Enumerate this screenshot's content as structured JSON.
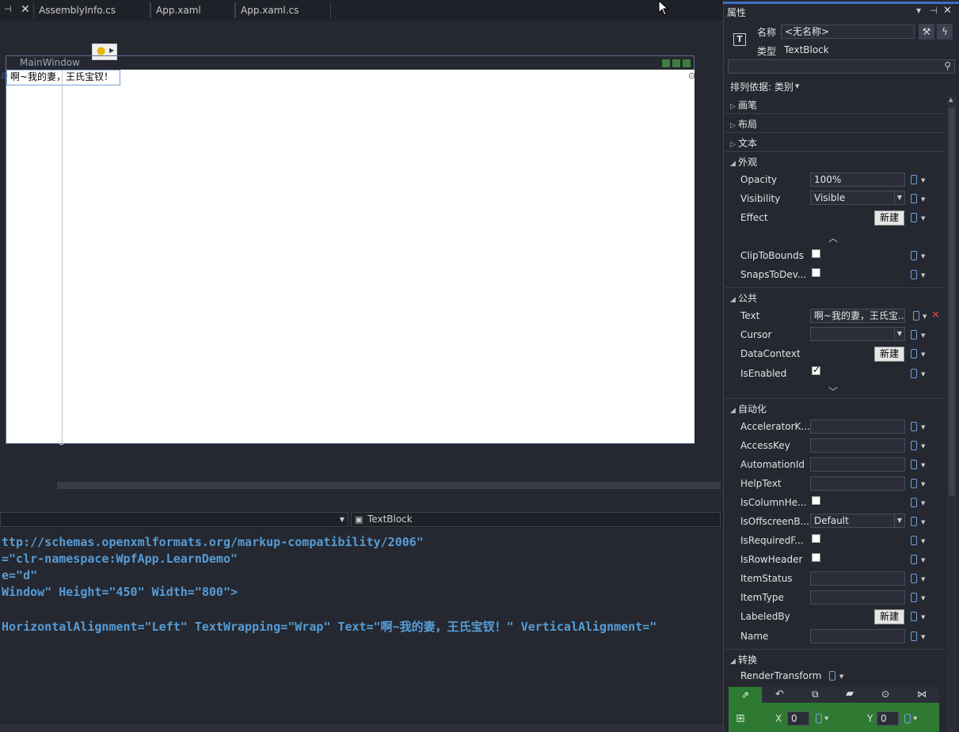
{
  "tabs": [
    "AssemblyInfo.cs",
    "App.xaml",
    "App.xaml.cs"
  ],
  "designer": {
    "window_title": "MainWindow",
    "textblock_text": "啊~我的妻，王氏宝钗！"
  },
  "editor": {
    "breadcrumb_right": "TextBlock",
    "lines": [
      {
        "text": "ttp://schemas.openxmlformats.org/markup-compatibility/2006\""
      },
      {
        "text": "=\"clr-namespace:WpfApp.LearnDemo\""
      },
      {
        "text": "e=\"d\""
      },
      {
        "text": "Window\" Height=\"450\" Width=\"800\">"
      },
      {
        "text": ""
      },
      {
        "text": "HorizontalAlignment=\"Left\" TextWrapping=\"Wrap\" Text=\"啊~我的妻，王氏宝钗！\" VerticalAlignment=\""
      }
    ]
  },
  "props": {
    "header": "属性",
    "name_label": "名称",
    "name_value": "<无名称>",
    "type_label": "类型",
    "type_value": "TextBlock",
    "sort_label": "排列依据: 类别",
    "collapsed_cats": [
      "画笔",
      "布局",
      "文本"
    ],
    "appearance": {
      "title": "外观",
      "opacity_label": "Opacity",
      "opacity_value": "100%",
      "visibility_label": "Visibility",
      "visibility_value": "Visible",
      "effect_label": "Effect",
      "new_btn": "新建",
      "clip_label": "ClipToBounds",
      "snaps_label": "SnapsToDev..."
    },
    "common": {
      "title": "公共",
      "text_label": "Text",
      "text_value": "啊~我的妻，王氏宝...",
      "cursor_label": "Cursor",
      "datacontext_label": "DataContext",
      "isenabled_label": "IsEnabled"
    },
    "automation": {
      "title": "自动化",
      "rows": [
        {
          "label": "AcceleratorK...",
          "kind": "field"
        },
        {
          "label": "AccessKey",
          "kind": "field"
        },
        {
          "label": "AutomationId",
          "kind": "field"
        },
        {
          "label": "HelpText",
          "kind": "field"
        },
        {
          "label": "IsColumnHe...",
          "kind": "check"
        },
        {
          "label": "IsOffscreenB...",
          "kind": "combo",
          "value": "Default"
        },
        {
          "label": "IsRequiredF...",
          "kind": "check"
        },
        {
          "label": "IsRowHeader",
          "kind": "check"
        },
        {
          "label": "ItemStatus",
          "kind": "field"
        },
        {
          "label": "ItemType",
          "kind": "field"
        },
        {
          "label": "LabeledBy",
          "kind": "button",
          "value": "新建"
        },
        {
          "label": "Name",
          "kind": "field"
        }
      ]
    },
    "transform": {
      "title": "转换",
      "render_label": "RenderTransform",
      "x_label": "X",
      "x_value": "0",
      "y_label": "Y",
      "y_value": "0"
    }
  }
}
